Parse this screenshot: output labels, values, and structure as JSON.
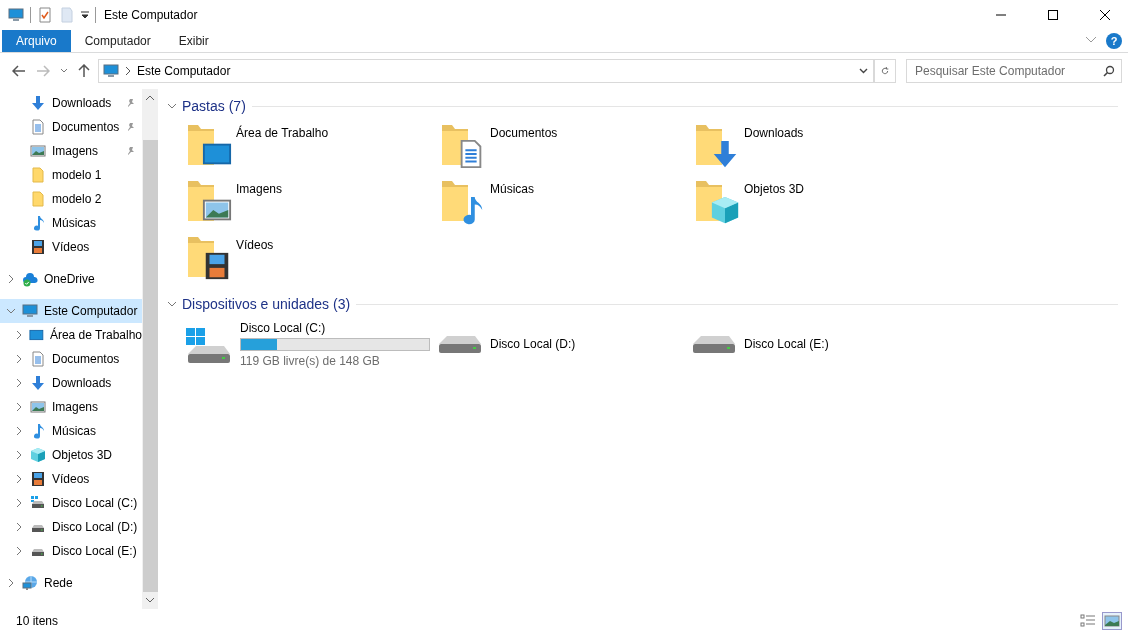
{
  "window": {
    "title": "Este Computador"
  },
  "ribbon": {
    "tabs": [
      {
        "label": "Arquivo",
        "selected": true
      },
      {
        "label": "Computador",
        "selected": false
      },
      {
        "label": "Exibir",
        "selected": false
      }
    ],
    "help": "?"
  },
  "address_bar": {
    "path": "Este Computador",
    "search_placeholder": "Pesquisar Este Computador"
  },
  "navigation": {
    "quick_access": [
      {
        "label": "Downloads",
        "kind": "download",
        "pinned": true
      },
      {
        "label": "Documentos",
        "kind": "document",
        "pinned": true
      },
      {
        "label": "Imagens",
        "kind": "picture",
        "pinned": true
      },
      {
        "label": "modelo 1",
        "kind": "folder",
        "pinned": false
      },
      {
        "label": "modelo 2",
        "kind": "folder",
        "pinned": false
      },
      {
        "label": "Músicas",
        "kind": "music",
        "pinned": false
      },
      {
        "label": "Vídeos",
        "kind": "video",
        "pinned": false
      }
    ],
    "tree": [
      {
        "label": "OneDrive",
        "kind": "onedrive",
        "expanded": false,
        "selected": false
      },
      {
        "label": "Este Computador",
        "kind": "computer",
        "expanded": true,
        "selected": true,
        "children": [
          {
            "label": "Área de Trabalho",
            "kind": "desktop",
            "expanded": false,
            "selected": false
          },
          {
            "label": "Documentos",
            "kind": "document",
            "expanded": false,
            "selected": false
          },
          {
            "label": "Downloads",
            "kind": "download",
            "expanded": false,
            "selected": false
          },
          {
            "label": "Imagens",
            "kind": "picture",
            "expanded": false,
            "selected": false
          },
          {
            "label": "Músicas",
            "kind": "music",
            "expanded": false,
            "selected": false
          },
          {
            "label": "Objetos 3D",
            "kind": "cube",
            "expanded": false,
            "selected": false
          },
          {
            "label": "Vídeos",
            "kind": "video",
            "expanded": false,
            "selected": false
          },
          {
            "label": "Disco Local (C:)",
            "kind": "drive_windows",
            "expanded": false,
            "selected": false
          },
          {
            "label": "Disco Local (D:)",
            "kind": "drive",
            "expanded": false,
            "selected": false
          },
          {
            "label": "Disco Local (E:)",
            "kind": "drive",
            "expanded": false,
            "selected": false
          }
        ]
      },
      {
        "label": "Rede",
        "kind": "network",
        "expanded": false,
        "selected": false
      }
    ]
  },
  "groups": [
    {
      "title": "Pastas (7)",
      "expanded": true,
      "items": [
        {
          "label": "Área de Trabalho",
          "kind": "desktop"
        },
        {
          "label": "Documentos",
          "kind": "document"
        },
        {
          "label": "Downloads",
          "kind": "download"
        },
        {
          "label": "Imagens",
          "kind": "picture"
        },
        {
          "label": "Músicas",
          "kind": "music"
        },
        {
          "label": "Objetos 3D",
          "kind": "cube"
        },
        {
          "label": "Vídeos",
          "kind": "video"
        }
      ]
    },
    {
      "title": "Dispositivos e unidades (3)",
      "expanded": true,
      "items": [
        {
          "label": "Disco Local (C:)",
          "kind": "drive_windows",
          "level": 0.19,
          "free": "119 GB livre(s) de 148 GB"
        },
        {
          "label": "Disco Local (D:)",
          "kind": "drive"
        },
        {
          "label": "Disco Local (E:)",
          "kind": "drive"
        }
      ]
    }
  ],
  "status_bar": {
    "count": "10 itens",
    "views": [
      {
        "kind": "details",
        "selected": false
      },
      {
        "kind": "tiles",
        "selected": true
      }
    ]
  }
}
